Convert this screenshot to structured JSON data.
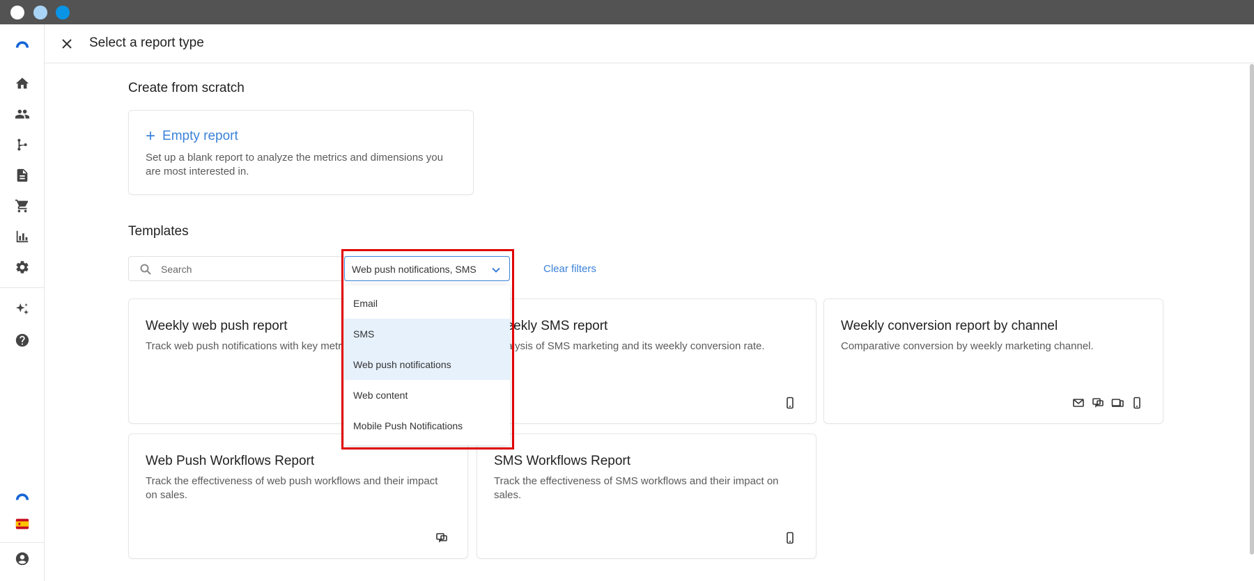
{
  "window": {
    "title_dots": [
      "close",
      "minimize",
      "maximize"
    ]
  },
  "header": {
    "title": "Select a report type"
  },
  "sidebar": {
    "items": [
      {
        "name": "logo"
      },
      {
        "name": "home"
      },
      {
        "name": "contacts"
      },
      {
        "name": "workflows"
      },
      {
        "name": "content"
      },
      {
        "name": "ecommerce"
      },
      {
        "name": "reports"
      },
      {
        "name": "settings"
      },
      {
        "name": "ai-assistant"
      },
      {
        "name": "help"
      },
      {
        "name": "account-logo"
      },
      {
        "name": "language-spain"
      },
      {
        "name": "user-profile"
      }
    ]
  },
  "scratch": {
    "section_title": "Create from scratch",
    "empty_report_label": "Empty report",
    "empty_report_desc": "Set up a blank report to analyze the metrics and dimensions you are most interested in."
  },
  "templates": {
    "section_title": "Templates",
    "search_placeholder": "Search",
    "filter_value": "Web push notifications, SMS",
    "clear_filters_label": "Clear filters",
    "dropdown_options": [
      {
        "label": "Email",
        "selected": false
      },
      {
        "label": "SMS",
        "selected": true
      },
      {
        "label": "Web push notifications",
        "selected": true
      },
      {
        "label": "Web content",
        "selected": false
      },
      {
        "label": "Mobile Push Notifications",
        "selected": false
      }
    ],
    "cards": [
      {
        "title": "Weekly web push report",
        "desc": "Track web push notifications with key metrics.",
        "channels": []
      },
      {
        "title": "Weekly SMS report",
        "desc": "Analysis of SMS marketing and its weekly conversion rate.",
        "channels": [
          "mobile-icon"
        ]
      },
      {
        "title": "Weekly conversion report by channel",
        "desc": "Comparative conversion by weekly marketing channel.",
        "channels": [
          "email-icon",
          "web-push-icon",
          "web-content-icon",
          "mobile-icon"
        ]
      },
      {
        "title": "Web Push Workflows Report",
        "desc": "Track the effectiveness of web push workflows and their impact on sales.",
        "channels": [
          "web-push-icon"
        ]
      },
      {
        "title": "SMS Workflows Report",
        "desc": "Track the effectiveness of SMS workflows and their impact on sales.",
        "channels": [
          "mobile-icon"
        ]
      }
    ]
  },
  "colors": {
    "accent": "#3b82d9",
    "highlight": "#e00000",
    "selected_bg": "#e6f1fc",
    "titlebar": "#535353"
  }
}
